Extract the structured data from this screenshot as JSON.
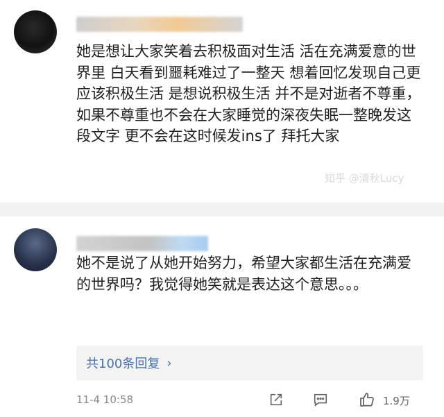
{
  "comments": [
    {
      "text": "她是想让大家笑着去积极面对生活 活在充满爱意的世界里 白天看到噩耗难过了一整天 想着回忆发现自己更应该积极生活 是想说积极生活 并不是对逝者不尊重， 如果不尊重也不会在大家睡觉的深夜失眠一整晚发这段文字 更不会在这时候发ins了 拜托大家"
    },
    {
      "text": "她不是说了从她开始努力，希望大家都生活在充满爱的世界吗？我觉得她笑就是表达这个意思。。。",
      "replies_label": "共100条回复",
      "time": "11-4 10:58",
      "likes": "1.9万"
    }
  ],
  "watermark": "知乎 @清秋Lucy",
  "icons": {
    "share": "share-icon",
    "comment": "comment-icon",
    "like": "thumbs-up-icon",
    "chevron": "chevron-right-icon"
  },
  "colors": {
    "link": "#4a73a6",
    "meta": "#8a8a8a",
    "divider": "#f2f2f2"
  }
}
